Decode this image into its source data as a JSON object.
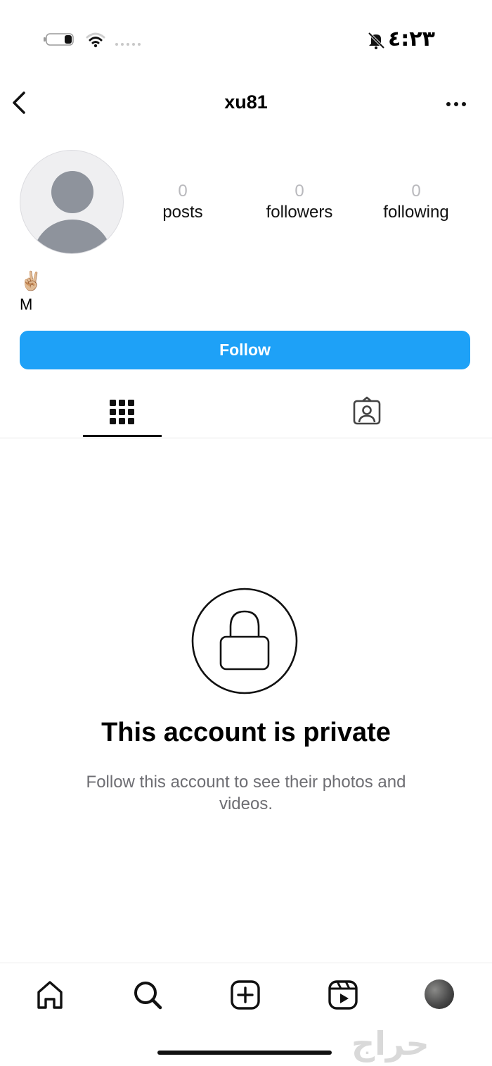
{
  "status_bar": {
    "time": "٤:٢٣",
    "icons": [
      "battery-icon",
      "wifi-icon",
      "signal-dots-icon",
      "bell-off-icon"
    ]
  },
  "header": {
    "username": "xu81",
    "back_icon": "chevron-left-icon",
    "more_icon": "more-horizontal-icon"
  },
  "profile": {
    "stats": [
      {
        "value": "0",
        "label": "posts"
      },
      {
        "value": "0",
        "label": "followers"
      },
      {
        "value": "0",
        "label": "following"
      }
    ],
    "bio_emoji": "✌🏼",
    "bio_name": "M"
  },
  "follow_button": {
    "label": "Follow"
  },
  "tabs": [
    {
      "icon": "grid-icon",
      "active": true
    },
    {
      "icon": "tagged-person-icon",
      "active": false
    }
  ],
  "private": {
    "title": "This account is private",
    "subtitle": "Follow this account to see their photos and videos."
  },
  "bottom_nav": {
    "items": [
      "home-icon",
      "search-icon",
      "new-post-icon",
      "reels-icon",
      "profile-avatar"
    ]
  },
  "watermark": "حراج",
  "colors": {
    "accent": "#1ea1f7",
    "muted_text": "#6e6e73",
    "stat_number": "#b9b9bd"
  }
}
